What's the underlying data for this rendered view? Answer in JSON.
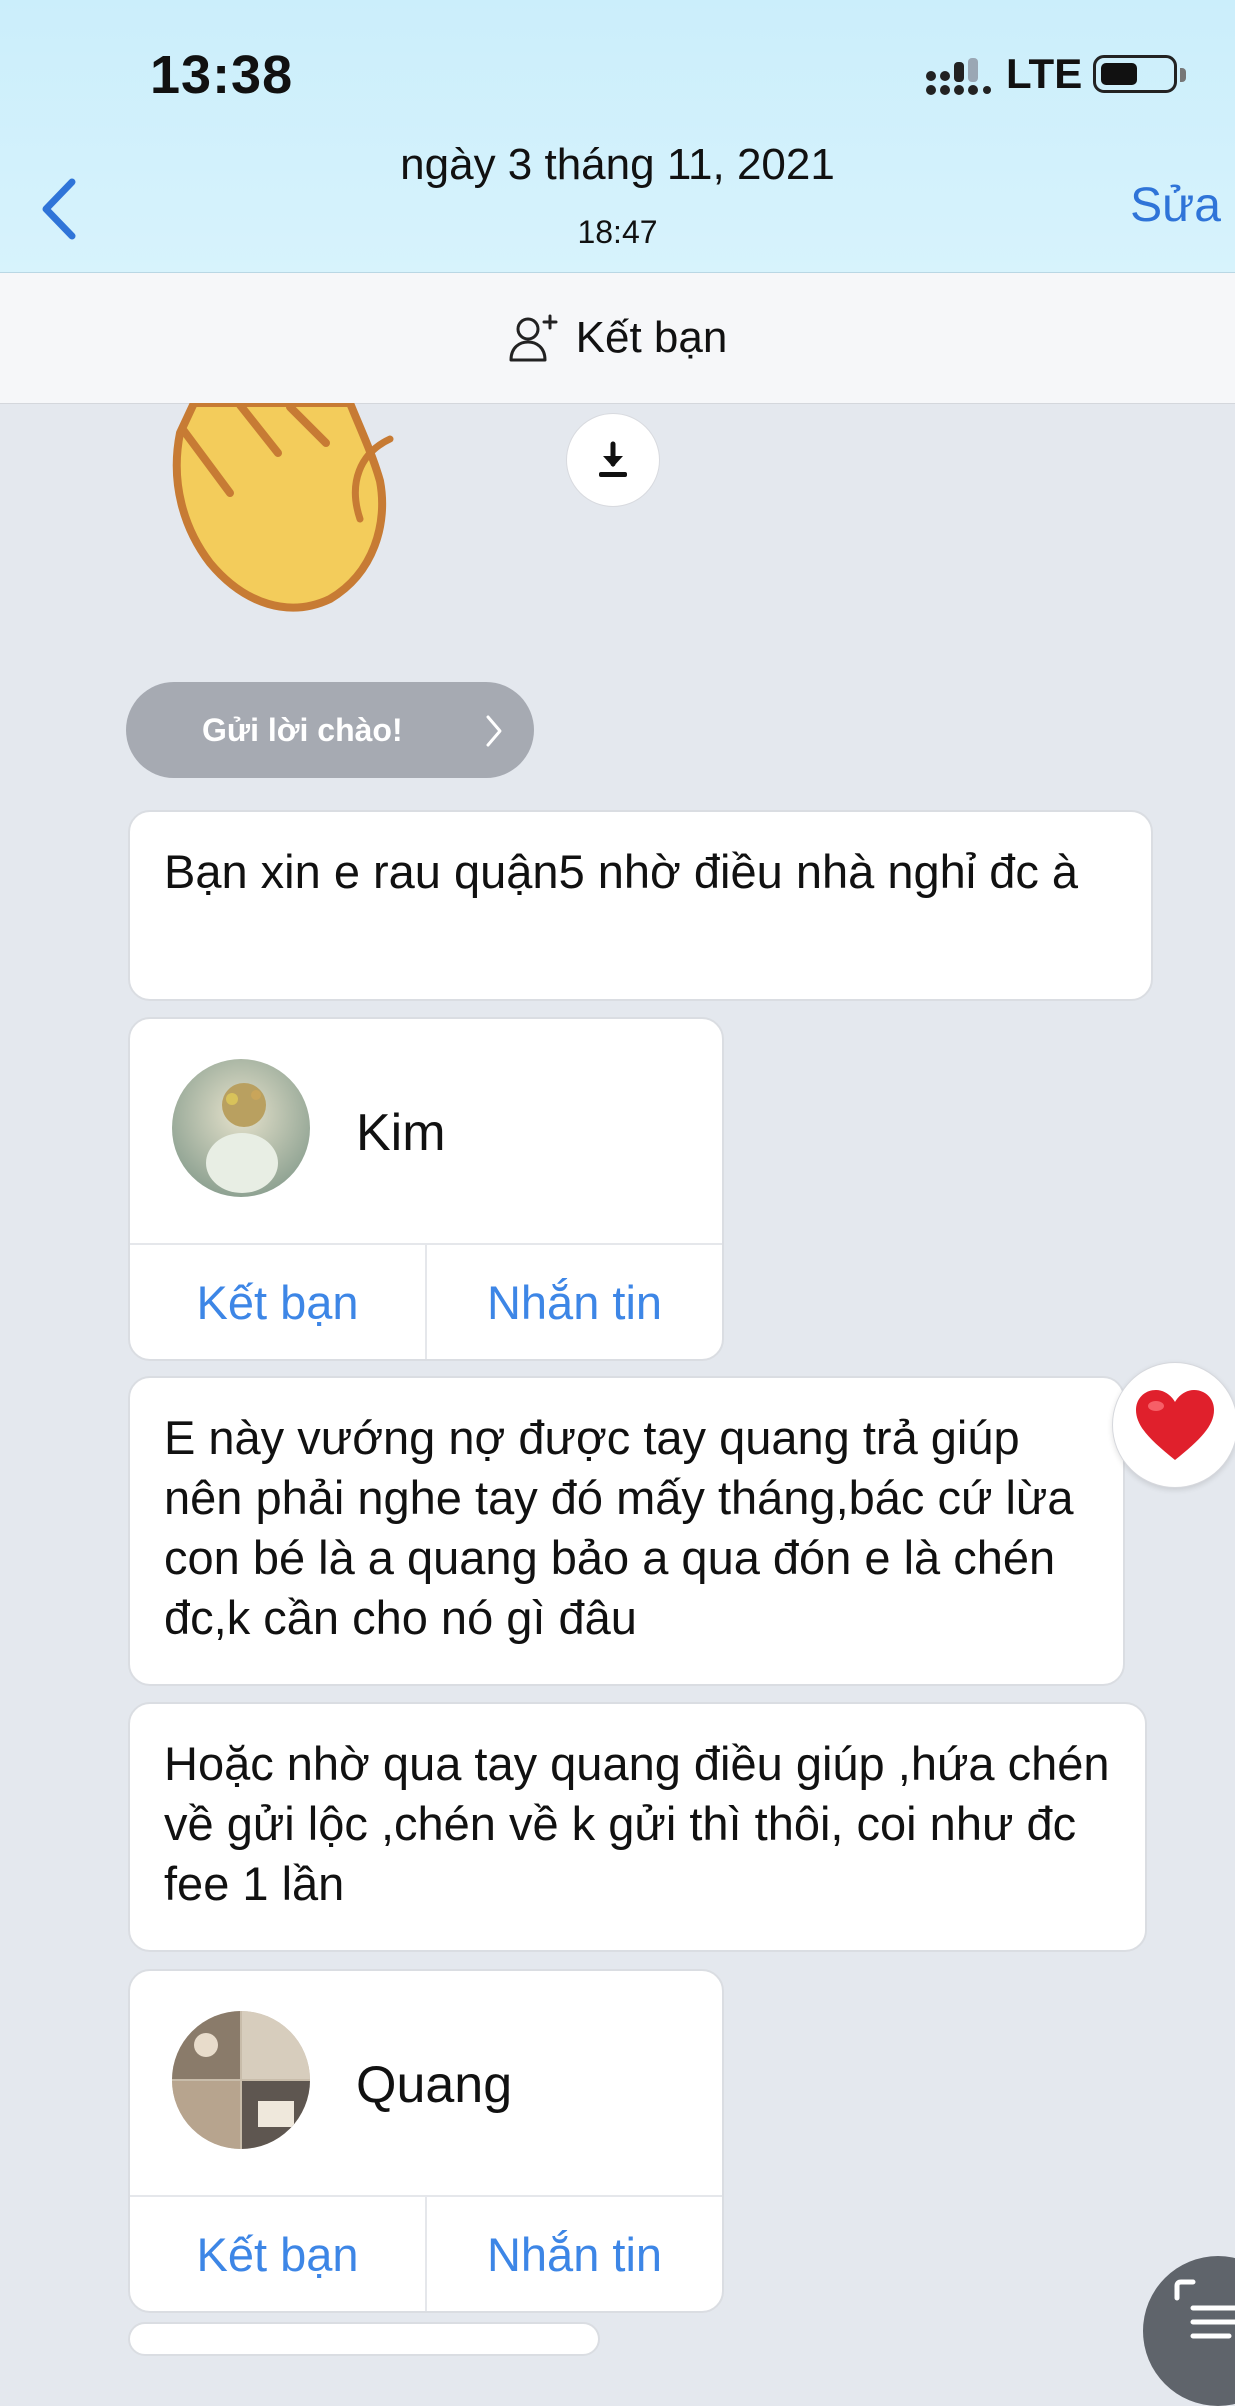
{
  "status_bar": {
    "time": "13:38",
    "network": "LTE"
  },
  "nav": {
    "date": "ngày 3 tháng 11, 2021",
    "time": "18:47",
    "edit_label": "Sửa"
  },
  "friend_bar": {
    "label": "Kết bạn"
  },
  "greeting_button": {
    "label": "Gửi lời chào!"
  },
  "messages": [
    {
      "text": "Bạn xin e rau quận5 nhờ điều nhà nghỉ đc à"
    },
    {
      "text": "E này vướng nợ được tay quang trả giúp nên phải nghe tay đó mấy tháng,bác cứ lừa con bé là a quang bảo a qua đón e là chén đc,k cần cho nó gì đâu",
      "reaction": "heart-icon"
    },
    {
      "text": "Hoặc nhờ qua tay quang điều giúp ,hứa chén về gửi lộc ,chén về k gửi thì thôi, coi như đc fee 1 lần"
    }
  ],
  "contact_cards": [
    {
      "name": "Kim",
      "add_friend_label": "Kết bạn",
      "message_label": "Nhắn tin"
    },
    {
      "name": "Quang",
      "add_friend_label": "Kết bạn",
      "message_label": "Nhắn tin"
    }
  ],
  "colors": {
    "header_bg": "#d7f3fc",
    "accent": "#3d86e6",
    "chat_bg": "#e4e8ee",
    "greet_bg": "#a6aab2",
    "heart": "#e0202c"
  }
}
